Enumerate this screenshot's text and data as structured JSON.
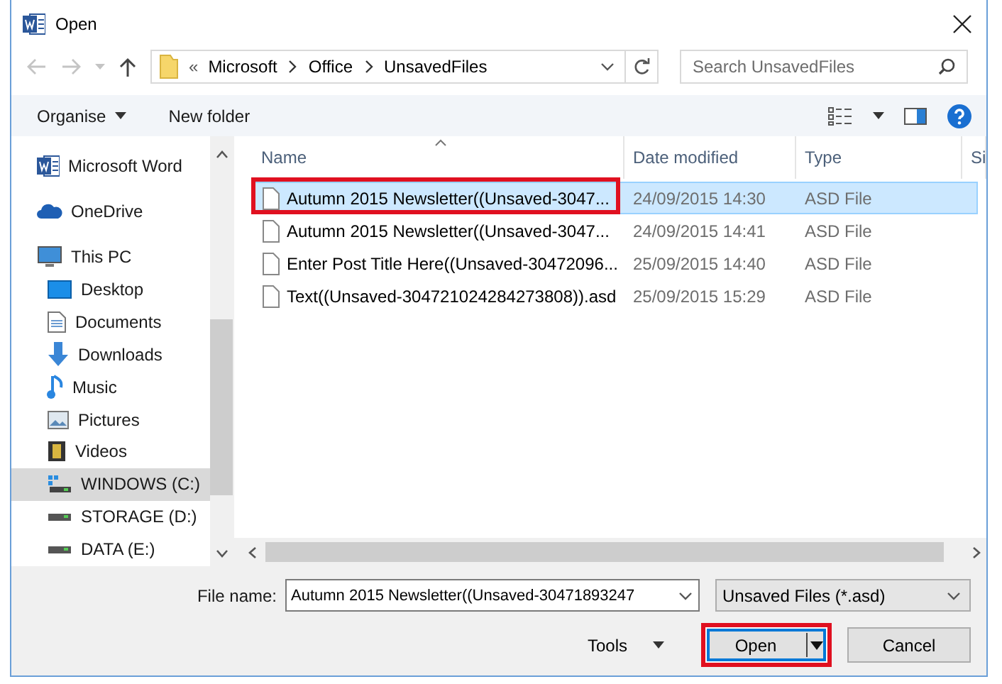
{
  "window": {
    "title": "Open"
  },
  "address": {
    "prefix": "«",
    "crumbs": [
      "Microsoft",
      "Office",
      "UnsavedFiles"
    ],
    "search_placeholder": "Search UnsavedFiles"
  },
  "toolbar": {
    "organise": "Organise",
    "new_folder": "New folder"
  },
  "sidebar": {
    "items": [
      {
        "label": "Microsoft Word",
        "kind": "word",
        "selected": false
      },
      {
        "label": "OneDrive",
        "kind": "cloud",
        "selected": false
      },
      {
        "label": "This PC",
        "kind": "pc",
        "selected": false,
        "children": [
          {
            "label": "Desktop",
            "kind": "desktop",
            "selected": false
          },
          {
            "label": "Documents",
            "kind": "documents",
            "selected": false
          },
          {
            "label": "Downloads",
            "kind": "downloads",
            "selected": false
          },
          {
            "label": "Music",
            "kind": "music",
            "selected": false
          },
          {
            "label": "Pictures",
            "kind": "pictures",
            "selected": false
          },
          {
            "label": "Videos",
            "kind": "videos",
            "selected": false
          },
          {
            "label": "WINDOWS (C:)",
            "kind": "windrive",
            "selected": true
          },
          {
            "label": "STORAGE (D:)",
            "kind": "drive",
            "selected": false
          },
          {
            "label": "DATA (E:)",
            "kind": "drive",
            "selected": false
          }
        ]
      }
    ]
  },
  "files": {
    "columns": [
      "Name",
      "Date modified",
      "Type",
      "Si"
    ],
    "rows": [
      {
        "name": "Autumn 2015 Newsletter((Unsaved-3047...",
        "date": "24/09/2015 14:30",
        "type": "ASD File",
        "selected": true,
        "highlighted": true
      },
      {
        "name": "Autumn 2015 Newsletter((Unsaved-3047...",
        "date": "24/09/2015 14:41",
        "type": "ASD File",
        "selected": false,
        "highlighted": false
      },
      {
        "name": "Enter Post Title Here((Unsaved-30472096...",
        "date": "25/09/2015 14:40",
        "type": "ASD File",
        "selected": false,
        "highlighted": false
      },
      {
        "name": "Text((Unsaved-304721024284273808)).asd",
        "date": "25/09/2015 15:29",
        "type": "ASD File",
        "selected": false,
        "highlighted": false
      }
    ]
  },
  "footer": {
    "file_name_label": "File name:",
    "file_name_value": "Autumn 2015 Newsletter((Unsaved-30471893247",
    "filter": "Unsaved Files (*.asd)",
    "tools": "Tools",
    "open": {
      "label": "Open",
      "highlighted": true
    },
    "cancel": "Cancel"
  }
}
